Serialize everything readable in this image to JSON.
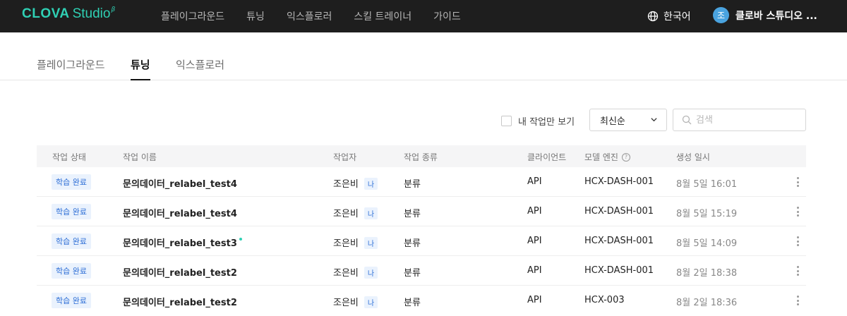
{
  "header": {
    "brand": "CLOVA",
    "brand_sub": "Studio",
    "brand_beta": "β",
    "nav": [
      "플레이그라운드",
      "튜닝",
      "익스플로러",
      "스킬 트레이너",
      "가이드"
    ],
    "language": "한국어",
    "user_initial": "조",
    "user_name": "클로바 스튜디오 ...",
    "icons": {
      "language": "globe-icon"
    },
    "colors": {
      "bar": "#1e1e1e",
      "brand": "#2fd0b4",
      "avatar": "#4aa3df"
    }
  },
  "tabs": [
    {
      "label": "플레이그라운드",
      "active": false
    },
    {
      "label": "튜닝",
      "active": true
    },
    {
      "label": "익스플로러",
      "active": false
    }
  ],
  "filters": {
    "mine_only_label": "내 작업만 보기",
    "mine_only_checked": false,
    "sort_value": "최신순",
    "search_placeholder": "검색"
  },
  "table": {
    "columns": [
      "작업 상태",
      "작업 이름",
      "작업자",
      "작업 종류",
      "클라이언트",
      "모델 엔진",
      "생성 일시"
    ],
    "me_tag": "나",
    "rows": [
      {
        "status": "학습 완료",
        "name": "문의데이터_relabel_test4",
        "is_new": false,
        "worker": "조은비",
        "type": "분류",
        "client": "API",
        "engine": "HCX-DASH-001",
        "created": "8월 5일 16:01"
      },
      {
        "status": "학습 완료",
        "name": "문의데이터_relabel_test4",
        "is_new": false,
        "worker": "조은비",
        "type": "분류",
        "client": "API",
        "engine": "HCX-DASH-001",
        "created": "8월 5일 15:19"
      },
      {
        "status": "학습 완료",
        "name": "문의데이터_relabel_test3",
        "is_new": true,
        "worker": "조은비",
        "type": "분류",
        "client": "API",
        "engine": "HCX-DASH-001",
        "created": "8월 5일 14:09"
      },
      {
        "status": "학습 완료",
        "name": "문의데이터_relabel_test2",
        "is_new": false,
        "worker": "조은비",
        "type": "분류",
        "client": "API",
        "engine": "HCX-DASH-001",
        "created": "8월 2일 18:38"
      },
      {
        "status": "학습 완료",
        "name": "문의데이터_relabel_test2",
        "is_new": false,
        "worker": "조은비",
        "type": "분류",
        "client": "API",
        "engine": "HCX-003",
        "created": "8월 2일 18:36"
      }
    ]
  }
}
